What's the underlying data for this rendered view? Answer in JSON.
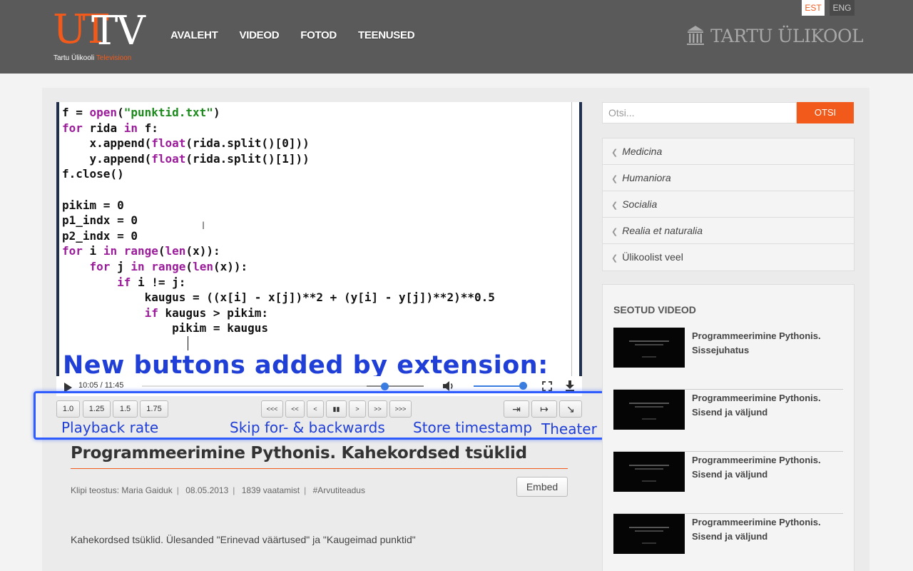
{
  "header": {
    "logo_ut": "UT",
    "logo_tv": "TV",
    "logo_sub_main": "Tartu Ülikooli",
    "logo_sub_accent": "Televisioon",
    "nav": [
      "AVALEHT",
      "VIDEOD",
      "FOTOD",
      "TEENUSED"
    ],
    "lang_est": "EST",
    "lang_eng": "ENG",
    "university": "TARTU ÜLIKOOL"
  },
  "video": {
    "code_lines": [
      "f = open(\"punktid.txt\")",
      "for rida in f:",
      "    x.append(float(rida.split()[0]))",
      "    y.append(float(rida.split()[1]))",
      "f.close()",
      "",
      "pikim = 0",
      "p1_indx = 0",
      "p2_indx = 0",
      "for i in range(len(x)):",
      "    for j in range(len(x)):",
      "        if i != j:",
      "            kaugus = ((x[i] - x[j])**2 + (y[i] - y[j])**2)**0.5",
      "            if kaugus > pikim:",
      "                pikim = kaugus"
    ],
    "overlay_title": "New buttons added by extension:",
    "time": "10:05 / 11:45",
    "progress": 0.876,
    "volume": 0.92
  },
  "extension": {
    "rates": [
      "1.0",
      "1.25",
      "1.5",
      "1.75"
    ],
    "skip": [
      "<<<",
      "<<",
      "<",
      "▮▮",
      ">",
      ">>",
      ">>>"
    ],
    "store": [
      "⇥",
      "↦",
      "↘"
    ],
    "labels": {
      "rate": "Playback rate",
      "skip": "Skip for- & backwards",
      "store": "Store timestamp",
      "theater": "Theater"
    }
  },
  "clip": {
    "title": "Programmeerimine Pythonis. Kahekordsed tsüklid",
    "meta_author": "Klipi teostus: Maria Gaiduk",
    "meta_date": "08.05.2013",
    "meta_views": "1839 vaatamist",
    "meta_tag": "#Arvutiteadus",
    "embed": "Embed",
    "description": "Kahekordsed tsüklid. Ülesanded \"Erinevad väärtused\" ja \"Kaugeimad punktid\""
  },
  "sidebar": {
    "search_placeholder": "Otsi...",
    "search_button": "OTSI",
    "categories": [
      "Medicina",
      "Humaniora",
      "Socialia",
      "Realia et naturalia",
      "Ülikoolist veel"
    ],
    "related_heading": "SEOTUD VIDEOD",
    "related": [
      "Programmeerimine Pythonis. Sissejuhatus",
      "Programmeerimine Pythonis. Sisend ja väljund",
      "Programmeerimine Pythonis. Sisend ja väljund",
      "Programmeerimine Pythonis. Sisend ja väljund"
    ]
  },
  "colors": {
    "accent": "#f25a1c",
    "header_bg": "#5a5a5a",
    "extension_blue": "#2f5cff"
  }
}
